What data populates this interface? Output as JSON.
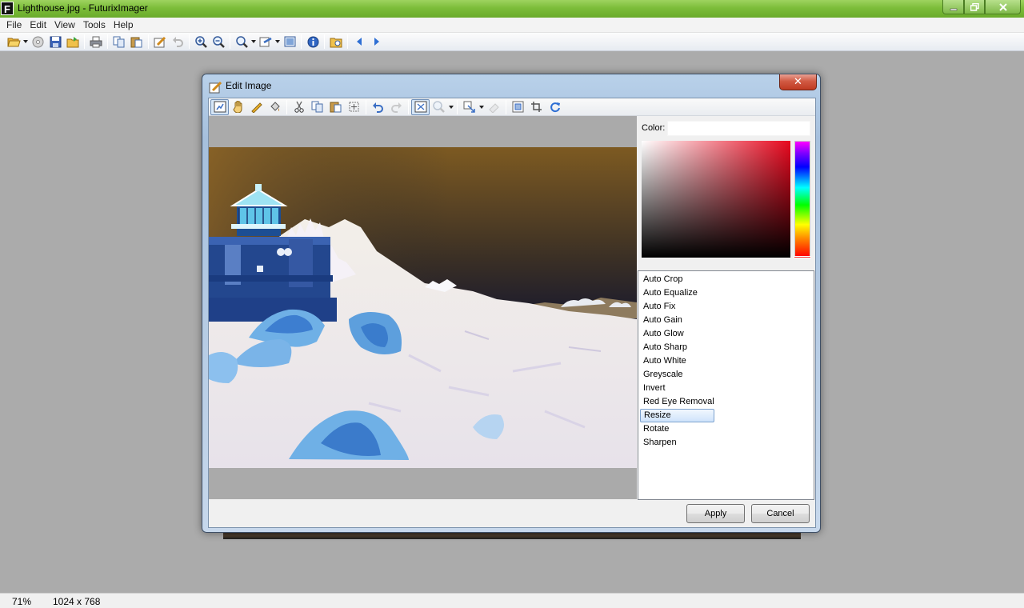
{
  "window": {
    "title": "Lighthouse.jpg - FuturixImager",
    "icon_letter": "F",
    "controls": {
      "minimize": "minimize-icon",
      "restore": "restore-icon",
      "close": "close-icon"
    }
  },
  "menu": [
    "File",
    "Edit",
    "View",
    "Tools",
    "Help"
  ],
  "toolbar_icons": [
    "open-icon",
    "burn-disc-icon",
    "save-icon",
    "open-folder-icon",
    "print-icon",
    "copy-icon",
    "paste-icon",
    "edit-image-icon",
    "undo-icon",
    "zoom-in-icon",
    "zoom-out-icon",
    "zoom-icon",
    "adjust-icon",
    "fullscreen-icon",
    "info-icon",
    "browse-folder-icon",
    "previous-icon",
    "next-icon"
  ],
  "status": {
    "zoom": "71%",
    "dimensions": "1024 x 768"
  },
  "dialog": {
    "title": "Edit Image",
    "close_label": "✕",
    "toolbar_icons": [
      "select-icon",
      "hand-icon",
      "pencil-icon",
      "fill-icon",
      "cut-icon",
      "copy-icon",
      "paste-icon",
      "select-all-icon",
      "undo-icon",
      "redo-icon",
      "fit-icon",
      "zoom-icon",
      "resize-icon",
      "eraser-icon",
      "canvas-icon",
      "crop-icon",
      "refresh-icon"
    ],
    "color_label": "Color:",
    "color_value": "",
    "effects": [
      "Auto Crop",
      "Auto Equalize",
      "Auto Fix",
      "Auto Gain",
      "Auto Glow",
      "Auto Sharp",
      "Auto White",
      "Greyscale",
      "Invert",
      "Red Eye Removal",
      "Resize",
      "Rotate",
      "Sharpen"
    ],
    "selected_effect": "Resize",
    "apply_label": "Apply",
    "cancel_label": "Cancel"
  },
  "colors": {
    "title_bar": "#7cbd3a",
    "selection": "#cfe3fb",
    "picker_hue": "#e8081e"
  }
}
